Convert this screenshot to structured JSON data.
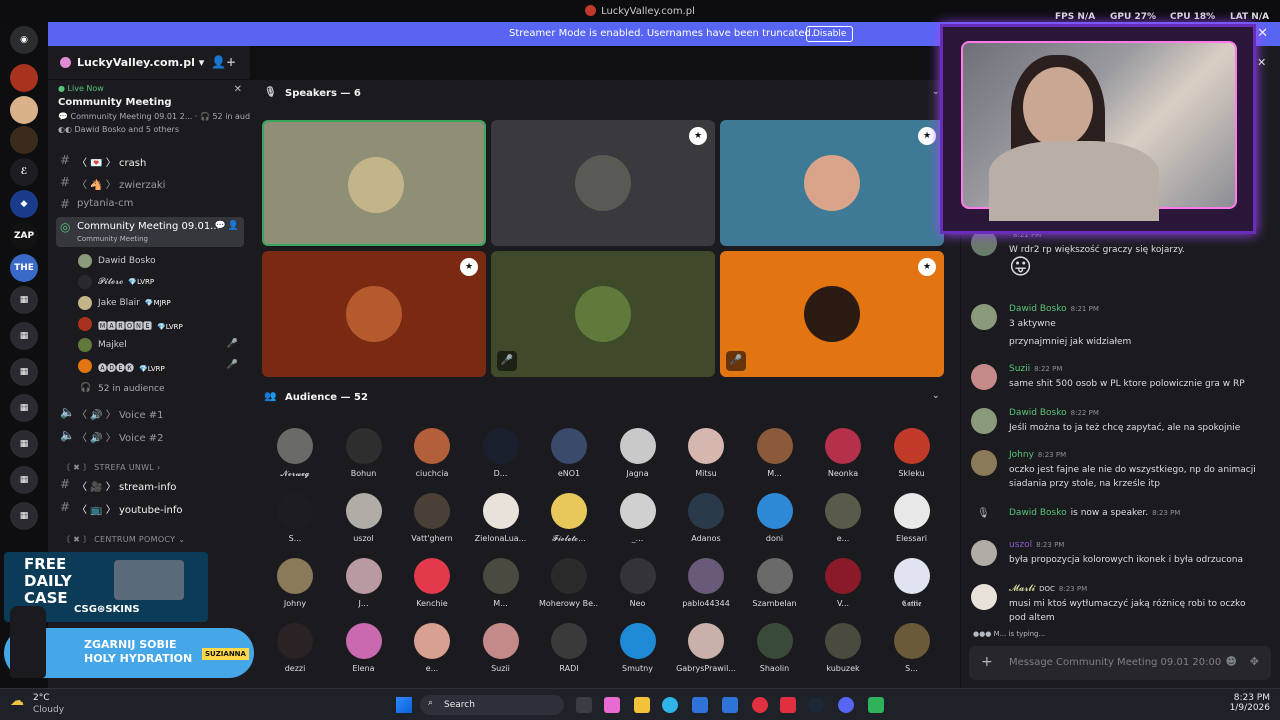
{
  "window": {
    "title": "LuckyValley.com.pl",
    "hud": {
      "fps_label": "FPS",
      "fps_value": "N/A",
      "gpu_label": "GPU",
      "gpu_value": "27%",
      "cpu_label": "CPU",
      "cpu_value": "18%",
      "lat_label": "LAT",
      "lat_value": "N/A"
    }
  },
  "banner": {
    "text": "Streamer Mode is enabled. Usernames have been truncated.",
    "disable_label": "Disable"
  },
  "server": {
    "name": "LuckyValley.com.pl"
  },
  "live_now": {
    "label": "Live Now",
    "title": "Community Meeting",
    "subtitle": "Community Meeting 09.01 2...",
    "audience": "52 in audience",
    "participants": "Dawid Bosko and 5 others"
  },
  "channels": [
    {
      "name": "crash",
      "emoji": "〈 💌 〉"
    },
    {
      "name": "zwierzaki",
      "emoji": "〈 🐴 〉"
    },
    {
      "name": "pytania-cm",
      "emoji": ""
    }
  ],
  "stage_channel": {
    "name": "Community Meeting 09.01...",
    "subtitle": "Community Meeting"
  },
  "stage_members": [
    {
      "name": "Dawid Bosko",
      "badge": ""
    },
    {
      "name": "𝓟𝓲𝓽𝓮𝓻𝓸",
      "badge": "💎LVRP"
    },
    {
      "name": "Jake Blair",
      "badge": "💎MJRP"
    },
    {
      "name": "🅼🅰🆁🅾🅽🅴",
      "badge": "💎LVRP"
    },
    {
      "name": "Majkel",
      "badge": ""
    },
    {
      "name": "🅐🅓🅔🅚",
      "badge": "💎LVRP"
    }
  ],
  "stage_audience_count": "52 in audience",
  "voice_channels": [
    {
      "name": "〈 🔊 〉 Voice #1"
    },
    {
      "name": "〈 🔊 〉 Voice #2"
    }
  ],
  "categories": {
    "strefa": "〔 ✖ 〕 STREFA UNWL",
    "centrum": "〔 ✖ 〕 CENTRUM POMOCY"
  },
  "info_channels": [
    {
      "name": "stream-info",
      "emoji": "〈 🎥 〉"
    },
    {
      "name": "youtube-info",
      "emoji": "〈 📺 〉"
    }
  ],
  "speakers": {
    "header": "Speakers — 6",
    "tiles": [
      {
        "bg": "#8f8f78",
        "avatar": "#c4b48a",
        "badge": false,
        "muted": false,
        "active": true
      },
      {
        "bg": "#3a3a3e",
        "avatar": "#5a5a55",
        "badge": true,
        "muted": false,
        "active": false
      },
      {
        "bg": "#3e7a96",
        "avatar": "#d9a48a",
        "badge": true,
        "muted": false,
        "active": false
      },
      {
        "bg": "#7a2a12",
        "avatar": "#b45a2c",
        "badge": true,
        "muted": false,
        "active": false
      },
      {
        "bg": "#3e4a2a",
        "avatar": "#5f7a3a",
        "badge": false,
        "muted": true,
        "active": false
      },
      {
        "bg": "#e27412",
        "avatar": "#2a1a12",
        "badge": true,
        "muted": true,
        "active": false
      }
    ]
  },
  "audience": {
    "header": "Audience — 52",
    "members": [
      {
        "name": "𝓝𝓸𝓻𝔀𝓮𝓰",
        "color": "#6a6a66"
      },
      {
        "name": "Bohun",
        "color": "#2e2e2e"
      },
      {
        "name": "ciuchcia",
        "color": "#b35f3a"
      },
      {
        "name": "D...",
        "color": "#1a1f2e"
      },
      {
        "name": "eNO1",
        "color": "#3a4a6a"
      },
      {
        "name": "Jagna",
        "color": "#c9c9c9"
      },
      {
        "name": "Mitsu",
        "color": "#d6b7b0"
      },
      {
        "name": "M...",
        "color": "#8a5a3a"
      },
      {
        "name": "Neonka",
        "color": "#b5304a"
      },
      {
        "name": "Skleku",
        "color": "#c23a2a"
      },
      {
        "name": "S...",
        "color": "#1c1c22"
      },
      {
        "name": "uszol",
        "color": "#b0aca6"
      },
      {
        "name": "Vatt'ghern",
        "color": "#4a4038"
      },
      {
        "name": "ZielonaLua...",
        "color": "#e8e2da"
      },
      {
        "name": "𝓕𝓲𝓸𝓵𝓮𝓽𝓸...",
        "color": "#e8c85a"
      },
      {
        "name": "_...",
        "color": "#d0d0d0"
      },
      {
        "name": "Adanos",
        "color": "#2a3a4a"
      },
      {
        "name": "doni",
        "color": "#2e8ad6"
      },
      {
        "name": "e...",
        "color": "#5a5a4a"
      },
      {
        "name": "Elessari",
        "color": "#e8e8e8"
      },
      {
        "name": "Johny",
        "color": "#8a7a5a"
      },
      {
        "name": "J...",
        "color": "#b89aa0"
      },
      {
        "name": "Kenchie",
        "color": "#e23a4a"
      },
      {
        "name": "M...",
        "color": "#4a4a40"
      },
      {
        "name": "Moherowy Be...",
        "color": "#2a2a2a"
      },
      {
        "name": "Neo",
        "color": "#333338"
      },
      {
        "name": "pablo44344",
        "color": "#6a5a7a"
      },
      {
        "name": "Szambelan",
        "color": "#6a6a6a"
      },
      {
        "name": "V...",
        "color": "#8a1a2a"
      },
      {
        "name": "𝕮𝖆𝖙𝖙𝖎𝖊",
        "color": "#e0e4f0"
      },
      {
        "name": "dezzi",
        "color": "#2a2224"
      },
      {
        "name": "Elena",
        "color": "#c96ab0"
      },
      {
        "name": "e...",
        "color": "#d8a090"
      },
      {
        "name": "Suzii",
        "color": "#c48a8a"
      },
      {
        "name": "RADI",
        "color": "#3a3a3a"
      },
      {
        "name": "Smutny",
        "color": "#1e8ad6"
      },
      {
        "name": "GabrysPrawil...",
        "color": "#c9b0a8"
      },
      {
        "name": "Shaolin",
        "color": "#3a4a3a"
      },
      {
        "name": "kubuzek",
        "color": "#4a4a3e"
      },
      {
        "name": "S...",
        "color": "#6a5a3a"
      }
    ]
  },
  "chat": {
    "messages": [
      {
        "author": "",
        "time": "8:21 PM",
        "text": "W rdr2 rp większość graczy się kojarzy.",
        "emoji": "😛",
        "color": "#57c27a",
        "avatar": "#6a7a6a"
      },
      {
        "author": "Dawid Bosko",
        "time": "8:21 PM",
        "text": "3 aktywne",
        "text2": "przynajmniej jak widziałem",
        "color": "#57c27a",
        "avatar": "#8a9a7a"
      },
      {
        "author": "Suzii",
        "time": "8:22 PM",
        "text": "same shit 500 osob w PL ktore polowicznie gra w RP",
        "color": "#57c27a",
        "avatar": "#c48a8a"
      },
      {
        "author": "Dawid Bosko",
        "time": "8:22 PM",
        "text": "Jeśli można to ja też chcę zapytać, ale na spokojnie",
        "color": "#57c27a",
        "avatar": "#8a9a7a"
      },
      {
        "author": "Johny",
        "time": "8:23 PM",
        "text": "oczko jest fajne ale nie do wszystkiego, np do animacji siadania przy stole, na krześle itp",
        "color": "#57c27a",
        "avatar": "#8a7a5a"
      },
      {
        "author": "Dawid Bosko",
        "time": "8:23 PM",
        "text": "is now a speaker.",
        "color": "#57c27a",
        "avatar": ""
      },
      {
        "author": "uszol",
        "time": "8:23 PM",
        "text": "była propozycja kolorowych ikonek i była odrzucona",
        "color": "#8a5ac8",
        "avatar": "#b0aca6"
      },
      {
        "author": "𝓜𝓪𝓻𝓵𝓲",
        "time": "8:23 PM",
        "text": "musi mi ktoś wytłumaczyć jaką różnicę robi to oczko pod altem",
        "tag": "DOC",
        "color": "#e8e2a8",
        "avatar": "#e8e2da"
      }
    ],
    "typing": "M... is typing...",
    "composer_placeholder": "Message Community Meeting 09.01 20:00"
  },
  "ad": {
    "free_line1": "FREE",
    "free_line2": "DAILY",
    "free_line3": "CASE",
    "csg": "CSG⊛SKINS",
    "promo_line1": "ZGARNIJ SOBIE",
    "promo_line2": "HOLY HYDRATION",
    "brand": "SUZIANNA"
  },
  "taskbar": {
    "weather_temp": "2°C",
    "weather_desc": "Cloudy",
    "search_placeholder": "Search",
    "time": "8:23 PM",
    "date": "1/9/2026"
  }
}
